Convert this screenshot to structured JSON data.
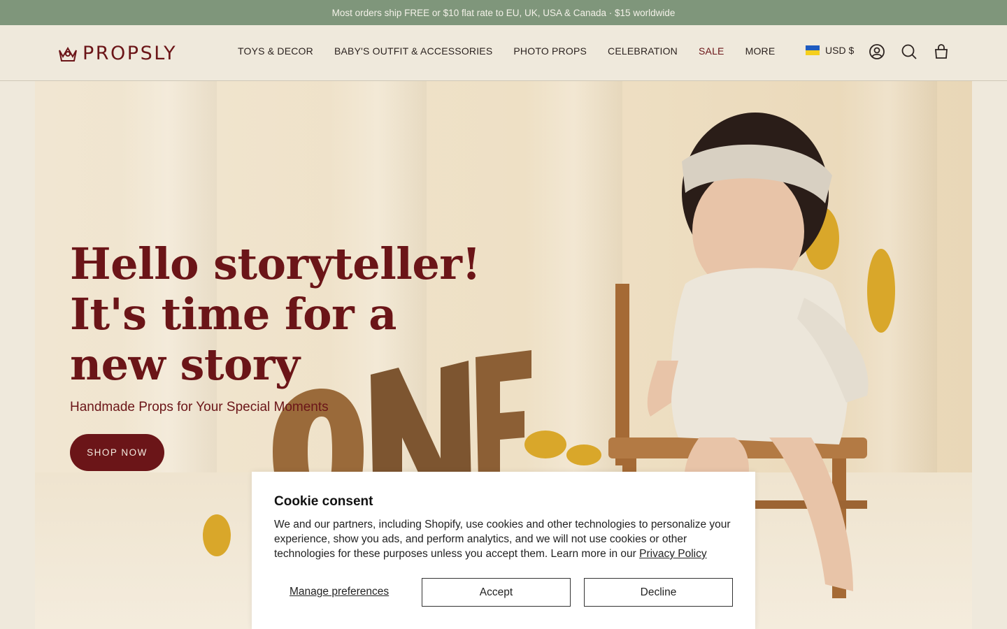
{
  "announcement": {
    "text": "Most orders ship FREE or $10 flat rate to EU, UK, USA & Canada · $15 worldwide"
  },
  "header": {
    "logo_text": "PROPSLY",
    "nav": [
      {
        "label": "TOYS & DECOR"
      },
      {
        "label": "BABY'S OUTFIT & ACCESSORIES"
      },
      {
        "label": "PHOTO PROPS"
      },
      {
        "label": "CELEBRATION"
      },
      {
        "label": "SALE"
      },
      {
        "label": "MORE"
      }
    ],
    "currency": "USD $",
    "icons": [
      "account-icon",
      "search-icon",
      "cart-icon"
    ]
  },
  "hero": {
    "title_lines": [
      "Hello storyteller!",
      "It's time for a",
      "new story"
    ],
    "subtitle": "Handmade Props for Your Special Moments",
    "cta": "SHOP NOW"
  },
  "cookie": {
    "title": "Cookie consent",
    "text": "We and our partners, including Shopify, use cookies and other technologies to personalize your experience, show you ads, and perform analytics, and we will not use cookies or other technologies for these purposes unless you accept them. Learn more in our",
    "link": "Privacy Policy",
    "manage": "Manage preferences",
    "accept": "Accept",
    "decline": "Decline"
  },
  "colors": {
    "announcement_bg": "#7f967b",
    "brand": "#6b1518",
    "page_bg": "#efe9dc"
  }
}
